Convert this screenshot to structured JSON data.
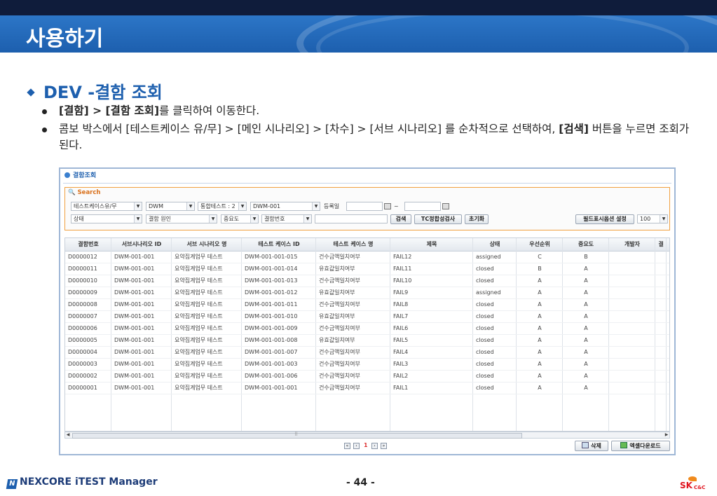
{
  "slide": {
    "title": "사용하기",
    "heading": "DEV -결함 조회",
    "bullet1": {
      "b1": "[결함]",
      "sep": " > ",
      "b2": "[결함 조회]",
      "rest": "를 클릭하여 이동한다."
    },
    "bullet2": {
      "text": "콤보 박스에서 [테스트케이스 유/무] > [메인 시나리오] > [차수] > [서브 시나리오] 를 순차적으로 선택하여, ",
      "bold": "[검색]",
      "rest": " 버튼을 누르면 조회가 된다."
    },
    "footer_logo": "NEXCORE iTEST Manager",
    "footer_logo_mark": "N",
    "page": "- 44 -",
    "sk_brand": "SK",
    "sk_sub": "C&C"
  },
  "app": {
    "title": "결함조회",
    "search_label": "Search",
    "row1": {
      "tc_select": "테스트케이스유/무",
      "main_select": "DWM",
      "round_select": "통합테스트 : 2",
      "sub_select": "DWM-001",
      "date_label": "등록일",
      "tilde": "~"
    },
    "row2": {
      "status_select": "상태",
      "cause_select": "결함 원인",
      "importance_select": "중요도",
      "defect_no_select": "결함번호",
      "search_btn": "검색",
      "tc_check_btn": "TC정합성검사",
      "reset_btn": "초기화",
      "field_btn": "필드표시옵션 설정",
      "page_size": "100"
    },
    "columns": [
      "결함번호",
      "서브시나리오 ID",
      "서브 시나리오 명",
      "테스트 케이스 ID",
      "테스트 케이스 명",
      "제목",
      "상태",
      "우선순위",
      "중요도",
      "개발자",
      "결"
    ],
    "rows": [
      [
        "D0000012",
        "DWM-001-001",
        "요약집계업무 테스트",
        "DWM-001-001-015",
        "건수금액일치여부",
        "FAIL12",
        "assigned",
        "C",
        "B"
      ],
      [
        "D0000011",
        "DWM-001-001",
        "요약집계업무 테스트",
        "DWM-001-001-014",
        "유효값일치여부",
        "FAIL11",
        "closed",
        "B",
        "A"
      ],
      [
        "D0000010",
        "DWM-001-001",
        "요약집계업무 테스트",
        "DWM-001-001-013",
        "건수금액일치여부",
        "FAIL10",
        "closed",
        "A",
        "A"
      ],
      [
        "D0000009",
        "DWM-001-001",
        "요약집계업무 테스트",
        "DWM-001-001-012",
        "유효값일치여부",
        "FAIL9",
        "assigned",
        "A",
        "A"
      ],
      [
        "D0000008",
        "DWM-001-001",
        "요약집계업무 테스트",
        "DWM-001-001-011",
        "건수금액일치여부",
        "FAIL8",
        "closed",
        "A",
        "A"
      ],
      [
        "D0000007",
        "DWM-001-001",
        "요약집계업무 테스트",
        "DWM-001-001-010",
        "유효값일치여부",
        "FAIL7",
        "closed",
        "A",
        "A"
      ],
      [
        "D0000006",
        "DWM-001-001",
        "요약집계업무 테스트",
        "DWM-001-001-009",
        "건수금액일치여부",
        "FAIL6",
        "closed",
        "A",
        "A"
      ],
      [
        "D0000005",
        "DWM-001-001",
        "요약집계업무 테스트",
        "DWM-001-001-008",
        "유효값일치여부",
        "FAIL5",
        "closed",
        "A",
        "A"
      ],
      [
        "D0000004",
        "DWM-001-001",
        "요약집계업무 테스트",
        "DWM-001-001-007",
        "건수금액일치여부",
        "FAIL4",
        "closed",
        "A",
        "A"
      ],
      [
        "D0000003",
        "DWM-001-001",
        "요약집계업무 테스트",
        "DWM-001-001-003",
        "건수금액일치여부",
        "FAIL3",
        "closed",
        "A",
        "A"
      ],
      [
        "D0000002",
        "DWM-001-001",
        "요약집계업무 테스트",
        "DWM-001-001-006",
        "건수금액일치여부",
        "FAIL2",
        "closed",
        "A",
        "A"
      ],
      [
        "D0000001",
        "DWM-001-001",
        "요약집계업무 테스트",
        "DWM-001-001-001",
        "건수금액일치여부",
        "FAIL1",
        "closed",
        "A",
        "A"
      ]
    ],
    "scroll_grip": "⠿",
    "pager": {
      "current": "1"
    },
    "bottom": {
      "delete_btn": "삭제",
      "excel_btn": "엑셀다운로드"
    }
  }
}
